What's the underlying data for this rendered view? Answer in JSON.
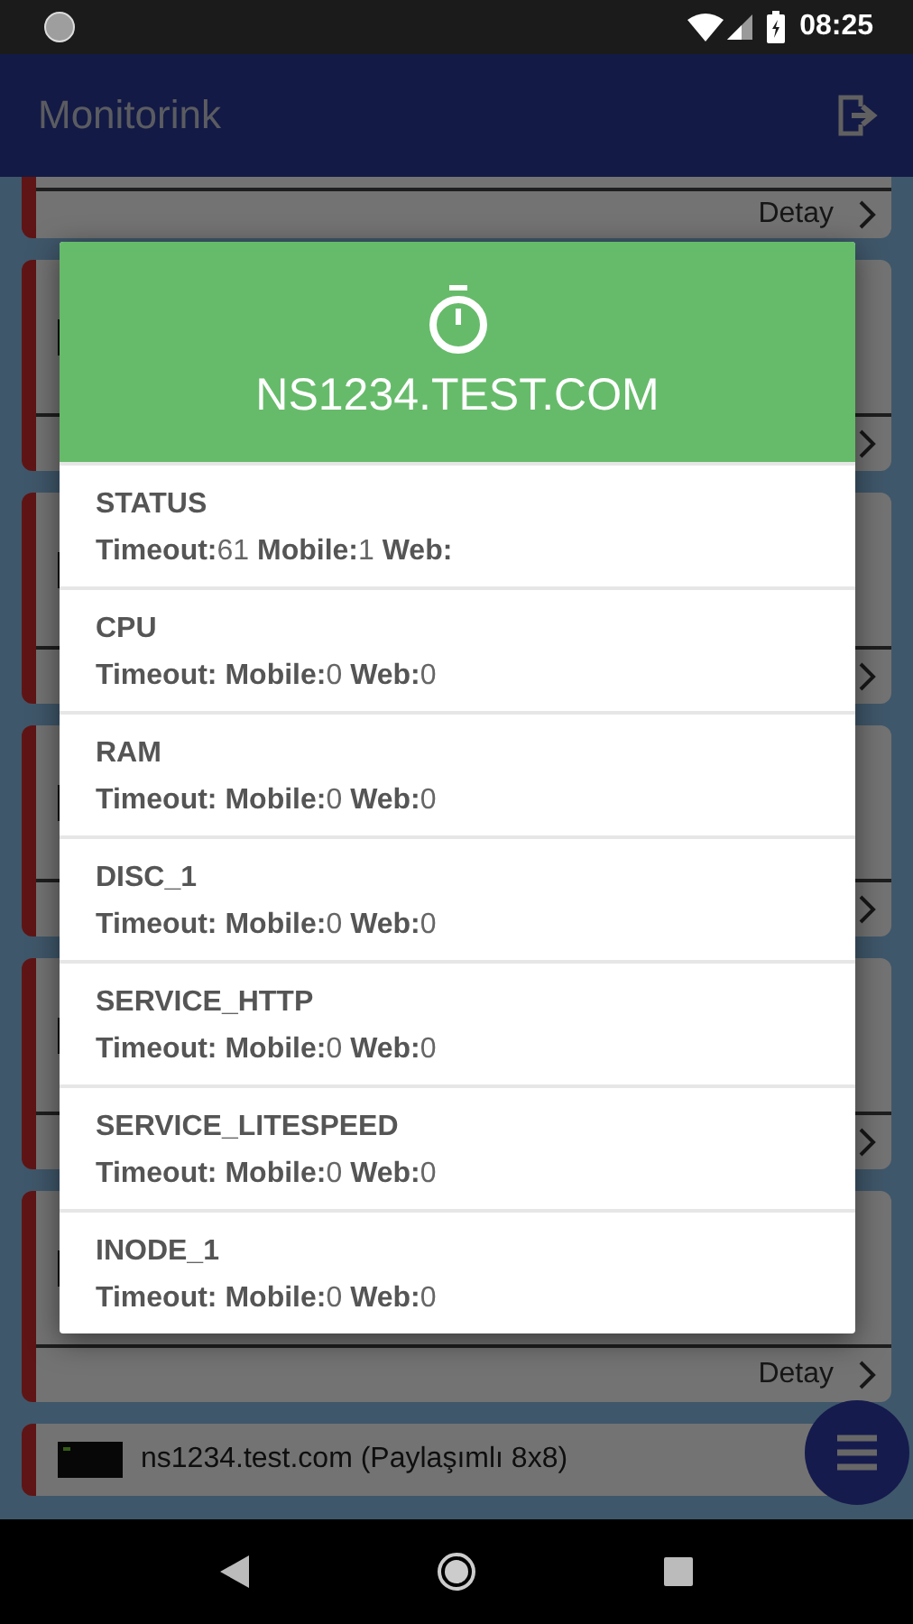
{
  "status_bar": {
    "time": "08:25"
  },
  "app_bar": {
    "title": "Monitorink"
  },
  "cards": [
    {
      "kind": "cut",
      "footer_label": "Detay"
    },
    {
      "kind": "covered"
    },
    {
      "kind": "covered"
    },
    {
      "kind": "covered"
    },
    {
      "kind": "covered"
    },
    {
      "kind": "covered",
      "footer_label": "Detay"
    },
    {
      "kind": "titled",
      "title": "ns1234.test.com (Paylaşımlı 8x8)"
    }
  ],
  "dialog": {
    "title": "NS1234.TEST.COM",
    "items": [
      {
        "name": "STATUS",
        "value": "**Timeout:**61 **Mobile:**1 **Web:**"
      },
      {
        "name": "CPU",
        "value": "**Timeout:** **Mobile:**0 **Web:**0"
      },
      {
        "name": "RAM",
        "value": "**Timeout:** **Mobile:**0 **Web:**0"
      },
      {
        "name": "DISC_1",
        "value": "**Timeout:** **Mobile:**0 **Web:**0"
      },
      {
        "name": "SERVICE_HTTP",
        "value": "**Timeout:** **Mobile:**0 **Web:**0"
      },
      {
        "name": "SERVICE_LITESPEED",
        "value": "**Timeout:** **Mobile:**0 **Web:**0"
      },
      {
        "name": "INODE_1",
        "value": "**Timeout:** **Mobile:**0 **Web:**0"
      }
    ]
  }
}
